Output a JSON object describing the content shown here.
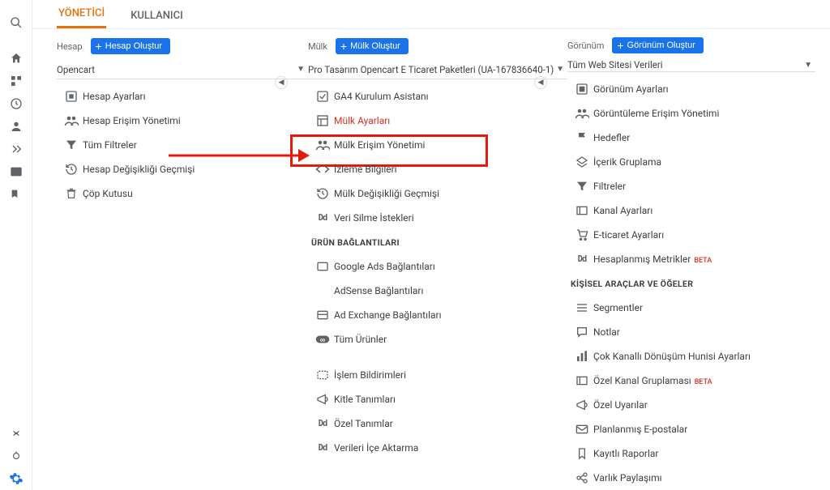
{
  "tabs": {
    "admin": "YÖNETİCİ",
    "user": "KULLANICI"
  },
  "account": {
    "label": "Hesap",
    "create": "Hesap Oluştur",
    "selected": "Opencart",
    "items": [
      {
        "icon": "settings-box",
        "label": "Hesap Ayarları"
      },
      {
        "icon": "people",
        "label": "Hesap Erişim Yönetimi"
      },
      {
        "icon": "filter",
        "label": "Tüm Filtreler"
      },
      {
        "icon": "history",
        "label": "Hesap Değişikliği Geçmişi"
      },
      {
        "icon": "trash",
        "label": "Çöp Kutusu"
      }
    ]
  },
  "property": {
    "label": "Mülk",
    "create": "Mülk Oluştur",
    "selected": "Pro Tasarım Opencart E Ticaret Paketleri (UA-167836640-1)",
    "items": [
      {
        "icon": "check-box",
        "label": "GA4 Kurulum Asistanı"
      },
      {
        "icon": "layout",
        "label": "Mülk Ayarları",
        "danger": true
      },
      {
        "icon": "people",
        "label": "Mülk Erişim Yönetimi"
      },
      {
        "icon": "code",
        "label": "İzleme Bilgileri"
      },
      {
        "icon": "history",
        "label": "Mülk Değişikliği Geçmişi"
      },
      {
        "icon": "dd",
        "label": "Veri Silme İstekleri"
      }
    ],
    "links_head": "ÜRÜN BAĞLANTILARI",
    "links": [
      {
        "icon": "ads",
        "label": "Google Ads Bağlantıları"
      },
      {
        "icon": "",
        "label": "AdSense Bağlantıları"
      },
      {
        "icon": "exchange",
        "label": "Ad Exchange Bağlantıları"
      },
      {
        "icon": "infinity",
        "label": "Tüm Ürünler"
      }
    ],
    "more": [
      {
        "icon": "announce",
        "label": "İşlem Bildirimleri"
      },
      {
        "icon": "audience",
        "label": "Kitle Tanımları"
      },
      {
        "icon": "dd",
        "label": "Özel Tanımlar"
      },
      {
        "icon": "dd",
        "label": "Verileri İçe Aktarma"
      }
    ]
  },
  "view": {
    "label": "Görünüm",
    "create": "Görünüm Oluştur",
    "selected": "Tüm Web Sitesi Verileri",
    "items": [
      {
        "icon": "settings-box",
        "label": "Görünüm Ayarları"
      },
      {
        "icon": "people",
        "label": "Görüntüleme Erişim Yönetimi"
      },
      {
        "icon": "flag",
        "label": "Hedefler"
      },
      {
        "icon": "group",
        "label": "İçerik Gruplama"
      },
      {
        "icon": "filter",
        "label": "Filtreler"
      },
      {
        "icon": "channel",
        "label": "Kanal Ayarları"
      },
      {
        "icon": "cart",
        "label": "E-ticaret Ayarları"
      },
      {
        "icon": "dd",
        "label": "Hesaplanmış Metrikler",
        "beta": "BETA"
      }
    ],
    "personal_head": "KİŞİSEL ARAÇLAR VE ÖĞELER",
    "personal": [
      {
        "icon": "segments",
        "label": "Segmentler"
      },
      {
        "icon": "notes",
        "label": "Notlar"
      },
      {
        "icon": "funnel",
        "label": "Çok Kanallı Dönüşüm Hunisi Ayarları"
      },
      {
        "icon": "channel2",
        "label": "Özel Kanal Gruplaması",
        "beta": "BETA"
      },
      {
        "icon": "alert",
        "label": "Özel Uyarılar"
      },
      {
        "icon": "mail",
        "label": "Planlanmış E-postalar"
      },
      {
        "icon": "saved",
        "label": "Kayıtlı Raporlar"
      },
      {
        "icon": "share",
        "label": "Varlık Paylaşımı"
      }
    ]
  }
}
